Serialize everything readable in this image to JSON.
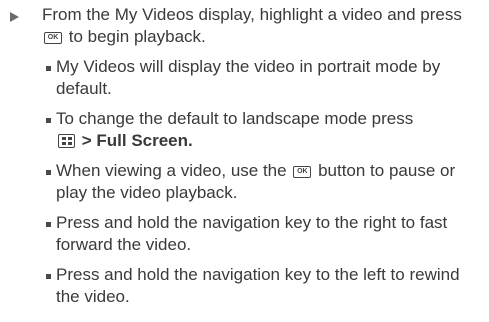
{
  "step": {
    "text_before": "From the My Videos display, highlight a video and press",
    "ok_key": "OK",
    "text_after": "to begin playback."
  },
  "bullets": [
    {
      "text": "My Videos will display the video in portrait mode by default."
    },
    {
      "text_before": "To change the default to landscape mode press",
      "menu_key_icon": "menu-key-icon",
      "text_after": "> Full Screen."
    },
    {
      "text_before": "When viewing a video, use the",
      "ok_key": "OK",
      "text_after": "button to pause or play the video playback."
    },
    {
      "text": "Press and hold the navigation key to the right to fast forward the video."
    },
    {
      "text": "Press and hold the navigation key to the left to rewind the video."
    }
  ]
}
